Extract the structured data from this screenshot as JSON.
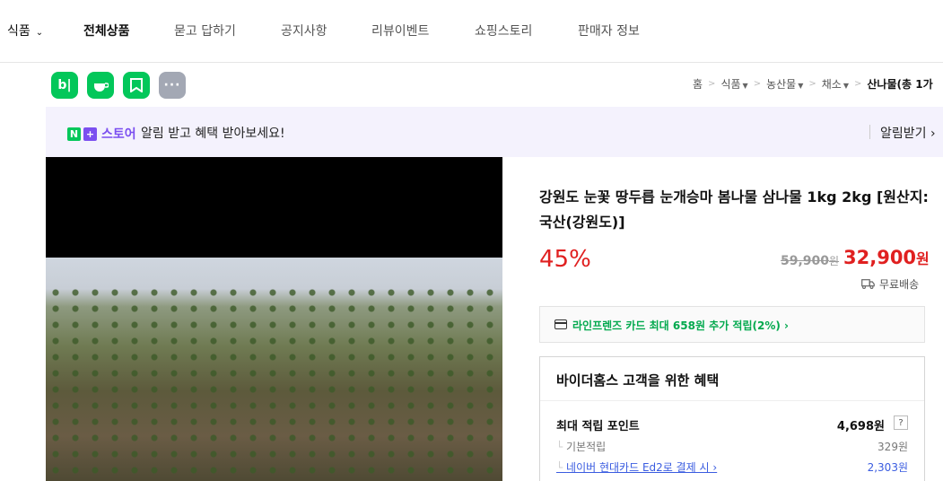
{
  "nav": {
    "category": "식품",
    "items": [
      "전체상품",
      "묻고 답하기",
      "공지사항",
      "리뷰이벤트",
      "쇼핑스토리",
      "판매자 정보"
    ]
  },
  "share": {
    "blog": "b|",
    "more": "···"
  },
  "breadcrumb": {
    "home": "홈",
    "level1": "식품",
    "level2": "농산물",
    "level3": "채소",
    "current": "산나물(총 1가"
  },
  "banner": {
    "n_letter": "N",
    "plus": "+",
    "store": "스토어",
    "message": "알림 받고 혜택 받아보세요!",
    "button": "알림받기 ›"
  },
  "product": {
    "title": "강원도 눈꽃 땅두릅 눈개승마 봄나물 삼나물 1kg 2kg [원산지:국산(강원도)]",
    "discount": "45%",
    "original_price": "59,900",
    "original_unit": "원",
    "sale_price": "32,900",
    "sale_unit": "원",
    "shipping": "무료배송",
    "card_promo": "라인프렌즈 카드 최대 658원 추가 적립(2%) ›"
  },
  "benefits": {
    "title": "바이더홈스 고객을 위한 혜택",
    "max_point_label": "최대 적립 포인트",
    "max_point_value": "4,698원",
    "help": "?",
    "basic_label": "기본적립",
    "basic_value": "329원",
    "card_label": "네이버 현대카드 Ed2로 결제 시 ›",
    "card_value": "2,303원"
  },
  "colors": {
    "naver_green": "#03c75a",
    "store_purple": "#7b4ff0",
    "price_red": "#e02020",
    "link_blue": "#3a5ce0"
  }
}
